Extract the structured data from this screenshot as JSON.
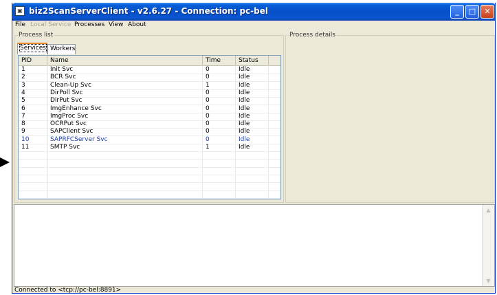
{
  "window": {
    "title": "biz2ScanServerClient - v2.6.27 - Connection: pc-bel"
  },
  "controls": {
    "minimize": "_",
    "maximize": "□",
    "close": "✕"
  },
  "menu": {
    "file": "File",
    "local_service": "Local Service",
    "processes": "Processes",
    "view": "View",
    "about": "About"
  },
  "process_list": {
    "label": "Process list",
    "tabs": [
      "Services",
      "Workers"
    ],
    "columns": [
      "PID",
      "Name",
      "Time",
      "Status"
    ],
    "rows": [
      [
        "1",
        "Init Svc",
        "0",
        "Idle"
      ],
      [
        "2",
        "BCR Svc",
        "0",
        "Idle"
      ],
      [
        "3",
        "Clean-Up Svc",
        "1",
        "Idle"
      ],
      [
        "4",
        "DirPoll Svc",
        "0",
        "Idle"
      ],
      [
        "5",
        "DirPut Svc",
        "0",
        "Idle"
      ],
      [
        "6",
        "ImgEnhance Svc",
        "0",
        "Idle"
      ],
      [
        "7",
        "ImgProc Svc",
        "0",
        "Idle"
      ],
      [
        "8",
        "OCRPut Svc",
        "0",
        "Idle"
      ],
      [
        "9",
        "SAPClient Svc",
        "0",
        "Idle"
      ],
      [
        "10",
        "SAPRFCServer Svc",
        "0",
        "Idle"
      ],
      [
        "11",
        "SMTP Svc",
        "1",
        "Idle"
      ]
    ],
    "highlight_color": "#1a3ca8"
  },
  "process_details": {
    "label": "Process details"
  },
  "status": {
    "text": "Connected to <tcp://pc-bel:8891>"
  }
}
